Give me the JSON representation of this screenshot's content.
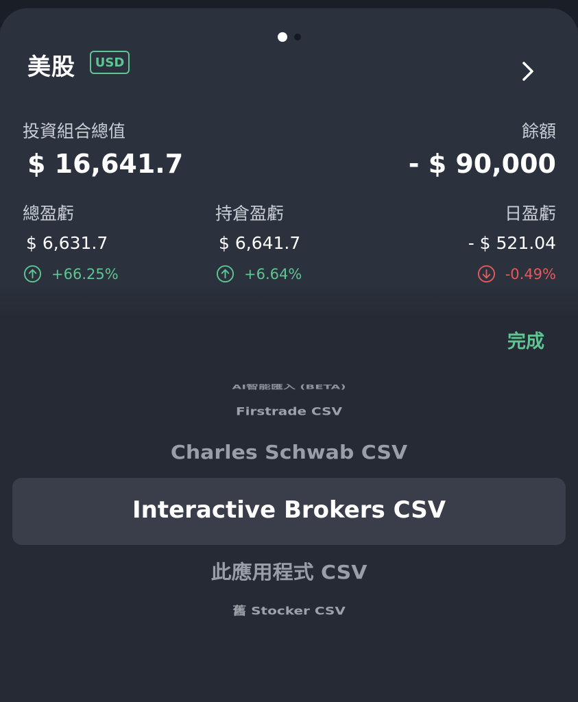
{
  "card": {
    "market": "美股",
    "currency": "USD",
    "portfolio": {
      "label": "投資組合總值",
      "value": "$ 16,641.7"
    },
    "balance": {
      "label": "餘額",
      "value": "- $ 90,000"
    },
    "total_pnl": {
      "label": "總盈虧",
      "value": "$ 6,631.7",
      "change": "+66.25%"
    },
    "position_pnl": {
      "label": "持倉盈虧",
      "value": "$ 6,641.7",
      "change": "+6.64%"
    },
    "daily_pnl": {
      "label": "日盈虧",
      "value": "- $ 521.04",
      "change": "-0.49%"
    }
  },
  "picker": {
    "done_label": "完成",
    "items": [
      "AI智能匯入 (BETA)",
      "Firstrade CSV",
      "Charles Schwab CSV",
      "Interactive Brokers CSV",
      "此應用程式 CSV",
      "舊 Stocker CSV"
    ],
    "selected": "Interactive Brokers CSV"
  },
  "colors": {
    "positive": "#5fc592",
    "negative": "#e35a5a",
    "card_bg": "#2b313d",
    "screen_bg": "#252a35"
  }
}
